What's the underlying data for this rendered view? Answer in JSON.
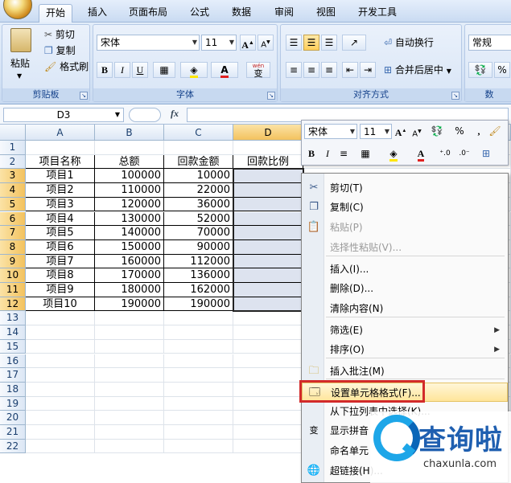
{
  "ribbon": {
    "tabs": [
      "开始",
      "插入",
      "页面布局",
      "公式",
      "数据",
      "审阅",
      "视图",
      "开发工具"
    ],
    "active_tab": "开始",
    "clipboard": {
      "paste": "粘贴",
      "cut": "剪切",
      "copy": "复制",
      "format_painter": "格式刷",
      "title": "剪贴板"
    },
    "font": {
      "name": "宋体",
      "size": "11",
      "bold": "B",
      "italic": "I",
      "underline": "U",
      "grow": "A",
      "shrink": "A",
      "font_color_glyph": "A",
      "pinyin": "wén",
      "pinyin_char": "变",
      "title": "字体"
    },
    "alignment": {
      "wrap_text": "自动换行",
      "merge_center": "合并后居中",
      "title": "对齐方式"
    },
    "number": {
      "format": "常规",
      "title": "数"
    }
  },
  "formula_bar": {
    "name_box": "D3",
    "fx": "fx",
    "content": ""
  },
  "sheet": {
    "columns": [
      "A",
      "B",
      "C",
      "D"
    ],
    "row_numbers": [
      "1",
      "2",
      "3",
      "4",
      "5",
      "6",
      "7",
      "8",
      "9",
      "10",
      "11",
      "12",
      "13",
      "14",
      "15",
      "16",
      "17",
      "18",
      "19",
      "20",
      "21",
      "22"
    ],
    "headers": [
      "项目名称",
      "总额",
      "回款金额",
      "回款比例"
    ],
    "rows": [
      [
        "项目1",
        "100000",
        "10000"
      ],
      [
        "项目2",
        "110000",
        "22000"
      ],
      [
        "项目3",
        "120000",
        "36000"
      ],
      [
        "项目4",
        "130000",
        "52000"
      ],
      [
        "项目5",
        "140000",
        "70000"
      ],
      [
        "项目6",
        "150000",
        "90000"
      ],
      [
        "项目7",
        "160000",
        "112000"
      ],
      [
        "项目8",
        "170000",
        "136000"
      ],
      [
        "项目9",
        "180000",
        "162000"
      ],
      [
        "项目10",
        "190000",
        "190000"
      ]
    ]
  },
  "mini_toolbar": {
    "font": "宋体",
    "size": "11",
    "bold": "B",
    "italic": "I",
    "percent": "%",
    "comma": ","
  },
  "context_menu": {
    "items": [
      {
        "label": "剪切(T)",
        "icon": "scissors-icon",
        "disabled": false
      },
      {
        "label": "复制(C)",
        "icon": "copy-icon",
        "disabled": false
      },
      {
        "label": "粘贴(P)",
        "icon": "paste-icon",
        "disabled": true
      },
      {
        "label": "选择性粘贴(V)...",
        "icon": "",
        "disabled": true
      },
      {
        "label": "插入(I)...",
        "icon": "",
        "disabled": false
      },
      {
        "label": "删除(D)...",
        "icon": "",
        "disabled": false
      },
      {
        "label": "清除内容(N)",
        "icon": "",
        "disabled": false
      },
      {
        "label": "筛选(E)",
        "icon": "",
        "disabled": false,
        "submenu": true
      },
      {
        "label": "排序(O)",
        "icon": "",
        "disabled": false,
        "submenu": true
      },
      {
        "label": "插入批注(M)",
        "icon": "comment-icon",
        "disabled": false
      },
      {
        "label": "设置单元格格式(F)...",
        "icon": "format-cells-icon",
        "disabled": false,
        "highlighted": true
      },
      {
        "label": "从下拉列表中选择(K)...",
        "icon": "",
        "disabled": false
      },
      {
        "label": "显示拼音",
        "icon": "pinyin-icon",
        "disabled": false
      },
      {
        "label": "命名单元",
        "icon": "",
        "disabled": false
      },
      {
        "label": "超链接(H)...",
        "icon": "hyperlink-icon",
        "disabled": false
      }
    ]
  },
  "watermark": {
    "title": "查询啦",
    "url": "chaxunla.com"
  },
  "colors": {
    "ribbon_blue": "#15428b",
    "highlight_red": "#d22a2a",
    "selection": "#dde3ef"
  }
}
